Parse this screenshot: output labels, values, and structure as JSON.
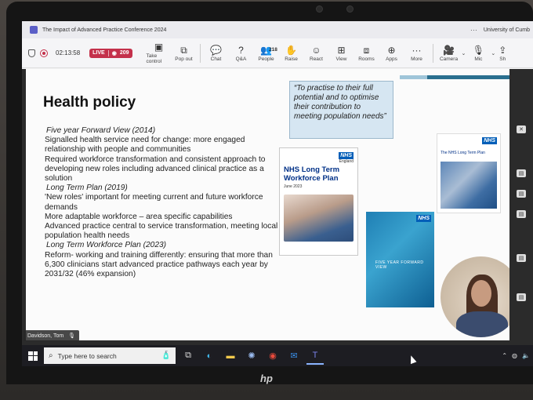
{
  "window": {
    "title": "The Impact of Advanced Practice Conference 2024",
    "org": "University of Cumb",
    "more": "···"
  },
  "toolbar": {
    "timer": "02:13:58",
    "live_label": "LIVE",
    "viewer_count": "209",
    "buttons": [
      {
        "label": "Take control",
        "icon": "take-control-icon",
        "glyph": "▣"
      },
      {
        "label": "Pop out",
        "icon": "pop-out-icon",
        "glyph": "⧉"
      },
      {
        "label": "Chat",
        "icon": "chat-icon",
        "glyph": "💬"
      },
      {
        "label": "Q&A",
        "icon": "qa-icon",
        "glyph": "?"
      },
      {
        "label": "People",
        "icon": "people-icon",
        "glyph": "👥",
        "badge": "218"
      },
      {
        "label": "Raise",
        "icon": "raise-hand-icon",
        "glyph": "✋"
      },
      {
        "label": "React",
        "icon": "react-icon",
        "glyph": "☺"
      },
      {
        "label": "View",
        "icon": "view-icon",
        "glyph": "⊞"
      },
      {
        "label": "Rooms",
        "icon": "rooms-icon",
        "glyph": "⧈"
      },
      {
        "label": "Apps",
        "icon": "apps-icon",
        "glyph": "⊕"
      },
      {
        "label": "More",
        "icon": "more-icon",
        "glyph": "···"
      },
      {
        "label": "Camera",
        "icon": "camera-icon",
        "glyph": "🎥"
      },
      {
        "label": "Mic",
        "icon": "mic-icon",
        "glyph": "🎙"
      },
      {
        "label": "Sh",
        "icon": "share-icon",
        "glyph": "⇪"
      }
    ]
  },
  "slide": {
    "title": "Health policy",
    "lines": [
      {
        "text": "Five year Forward View (2014)",
        "italic": true
      },
      {
        "text": "Signalled health service need for change: more engaged relationship with people and communities",
        "italic": false
      },
      {
        "text": "Required workforce transformation and consistent approach to developing new roles including advanced clinical practice as a solution",
        "italic": false
      },
      {
        "text": "Long Term Plan (2019)",
        "italic": true
      },
      {
        "text": "'New roles' important for meeting current and future workforce demands",
        "italic": false
      },
      {
        "text": "More adaptable workforce – area specific capabilities",
        "italic": false
      },
      {
        "text": "Advanced practice central to service transformation, meeting local population health needs",
        "italic": false
      },
      {
        "text": "Long Term Workforce Plan (2023)",
        "italic": true
      },
      {
        "text": "Reform- working and training differently: ensuring that more than 6,300 clinicians start advanced practice pathways each year by 2031/32 (46% expansion)",
        "italic": false
      }
    ],
    "quote": "“To practise to their full potential and to optimise their contribution to meeting population needs”",
    "doc1": {
      "logo": "NHS",
      "sub": "England",
      "title": "NHS Long Term Workforce Plan",
      "date": "June 2023"
    },
    "doc2": {
      "logo": "NHS",
      "title": "FIVE YEAR FORWARD VIEW"
    },
    "doc3": {
      "logo": "NHS",
      "title": "The NHS Long Term Plan"
    }
  },
  "participant": {
    "name": "Davidson, Tom"
  },
  "taskbar": {
    "search_placeholder": "Type here to search"
  },
  "colors": {
    "accent": "#5b5fc7",
    "live": "#c4314b",
    "nhs_blue": "#005eb8"
  }
}
